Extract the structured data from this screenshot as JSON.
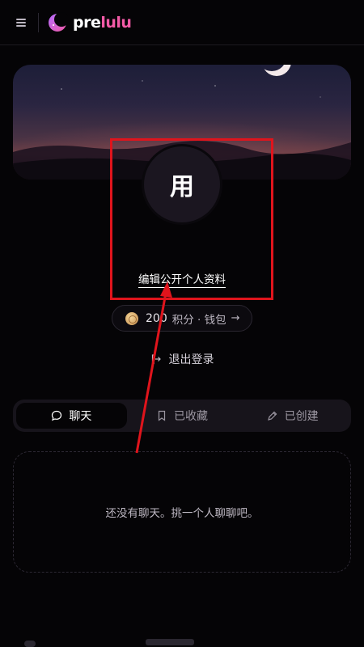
{
  "header": {
    "logo_text_main": "pre",
    "logo_text_accent": "lulu"
  },
  "profile": {
    "avatar_char": "用",
    "edit_link": "编辑公开个人资料"
  },
  "points": {
    "value": "200",
    "label": "积分 · 钱包",
    "arrow": "→"
  },
  "logout": {
    "label": "退出登录"
  },
  "tabs": [
    {
      "label": "聊天",
      "icon": "chat-bubble-icon",
      "active": true
    },
    {
      "label": "已收藏",
      "icon": "bookmark-icon",
      "active": false
    },
    {
      "label": "已创建",
      "icon": "pen-icon",
      "active": false
    }
  ],
  "empty_state": {
    "message": "还没有聊天。挑一个人聊聊吧。"
  },
  "colors": {
    "background": "#050406",
    "accent_pink": "#f25aa6",
    "highlight_red": "#e0141c"
  }
}
